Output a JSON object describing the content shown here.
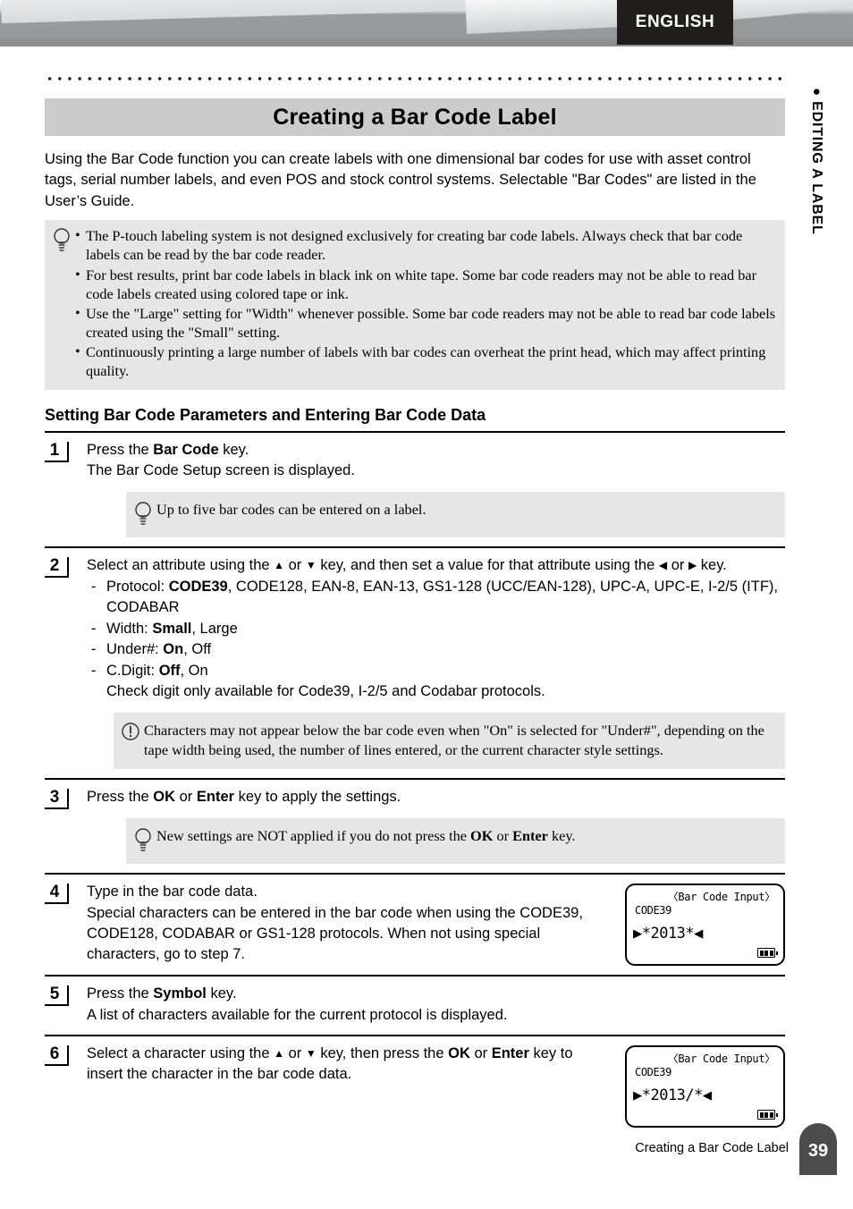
{
  "header": {
    "language_tab": "ENGLISH",
    "side_tab_bullet": "●",
    "side_tab_label": "EDITING A LABEL"
  },
  "chapter": {
    "title": "Creating a Bar Code Label",
    "intro": "Using the Bar Code function you can create labels with one dimensional bar codes for use with asset control tags, serial number labels, and even POS and stock control systems. Selectable \"Bar Codes\" are listed in the User’s Guide."
  },
  "intro_note": {
    "icon": "lightbulb-icon",
    "bullets": [
      "The P-touch labeling system is not designed exclusively for creating bar code labels. Always check that bar code labels can be read by the bar code reader.",
      "For best results, print bar code labels in black ink on white tape. Some bar code readers may not be able to read bar code labels created using colored tape or ink.",
      "Use the \"Large\" setting for \"Width\" whenever possible. Some bar code readers may not be able to read bar code labels created using the \"Small\" setting.",
      "Continuously printing a large number of labels with bar codes can overheat the print head, which may affect printing quality."
    ]
  },
  "section": {
    "heading": "Setting Bar Code Parameters and Entering Bar Code Data"
  },
  "steps": [
    {
      "number": "1",
      "line1_pre": "Press the ",
      "line1_bold": "Bar Code",
      "line1_post": " key.",
      "line2": "The Bar Code Setup screen is displayed.",
      "note": {
        "icon": "lightbulb-icon",
        "text": "Up to five bar codes can be entered on a label."
      }
    },
    {
      "number": "2",
      "line1_a": "Select an attribute using the ",
      "line1_up": "▲",
      "line1_b": " or ",
      "line1_down": "▼",
      "line1_c": " key, and then set a value for that attribute using the ",
      "line1_left": "◀",
      "line1_d": " or ",
      "line1_right": "▶",
      "line1_e": " key.",
      "attributes": [
        {
          "label": "Protocol: ",
          "default": "CODE39",
          "rest": ", CODE128, EAN-8, EAN-13, GS1-128 (UCC/EAN-128), UPC-A, UPC-E, I-2/5 (ITF), CODABAR"
        },
        {
          "label": "Width: ",
          "default": "Small",
          "rest": ", Large"
        },
        {
          "label": "Under#: ",
          "default": "On",
          "rest": ", Off"
        },
        {
          "label": "C.Digit: ",
          "default": "Off",
          "rest": ", On"
        }
      ],
      "attributes_footnote": "Check digit only available for Code39, I-2/5 and Codabar protocols.",
      "note": {
        "icon": "warning-icon",
        "text": "Characters may not appear below the bar code even when \"On\" is selected for \"Under#\", depending on the tape width being used, the number of lines entered, or the current character style settings."
      }
    },
    {
      "number": "3",
      "line1_pre": "Press the ",
      "line1_bold1": "OK",
      "line1_mid": " or ",
      "line1_bold2": "Enter",
      "line1_post": " key to apply the settings.",
      "note": {
        "icon": "lightbulb-icon",
        "text_pre": "New settings are NOT applied if you do not press the ",
        "text_bold1": "OK",
        "text_mid": " or ",
        "text_bold2": "Enter",
        "text_post": " key."
      }
    },
    {
      "number": "4",
      "line1": "Type in the bar code data.",
      "line2": "Special characters can be entered in the bar code when using the CODE39, CODE128, CODABAR or GS1-128 protocols. When not using special characters, go to step 7.",
      "lcd": {
        "title": "〈Bar Code Input〉",
        "protocol": "CODE39",
        "data": "▶*2013*◀",
        "battery": "battery-icon"
      }
    },
    {
      "number": "5",
      "line1_pre": "Press the ",
      "line1_bold": "Symbol",
      "line1_post": " key.",
      "line2": "A list of characters available for the current protocol is displayed."
    },
    {
      "number": "6",
      "line1_a": "Select a character using the ",
      "line1_up": "▲",
      "line1_b": " or ",
      "line1_down": "▼",
      "line1_c": " key, then press the ",
      "line1_bold1": "OK",
      "line1_d": " or ",
      "line1_bold2": "Enter",
      "line1_e": " key to insert the character in the bar code data.",
      "lcd": {
        "title": "〈Bar Code Input〉",
        "protocol": "CODE39",
        "data": "▶*2013/*◀",
        "battery": "battery-icon"
      }
    }
  ],
  "footer": {
    "text": "Creating a Bar Code Label",
    "page_number": "39"
  },
  "colors": {
    "title_bar": "#cccccc",
    "note_bg": "#e6e6e6",
    "lang_tab_bg": "#201d1d",
    "page_tab_bg": "#4c4c4c"
  }
}
